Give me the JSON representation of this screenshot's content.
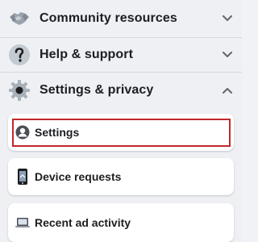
{
  "menu": {
    "sections": [
      {
        "label": "Community resources",
        "icon": "handshake-icon",
        "expanded": false
      },
      {
        "label": "Help & support",
        "icon": "question-icon",
        "expanded": false
      },
      {
        "label": "Settings & privacy",
        "icon": "gear-icon",
        "expanded": true
      }
    ],
    "settings_items": [
      {
        "label": "Settings",
        "icon": "person-icon",
        "highlighted": true
      },
      {
        "label": "Device requests",
        "icon": "phone-icon",
        "highlighted": false
      },
      {
        "label": "Recent ad activity",
        "icon": "laptop-icon",
        "highlighted": false
      }
    ]
  },
  "colors": {
    "background": "#eef0f3",
    "card": "#ffffff",
    "highlight_border": "#c2272d",
    "icon_gray": "#65676b"
  }
}
